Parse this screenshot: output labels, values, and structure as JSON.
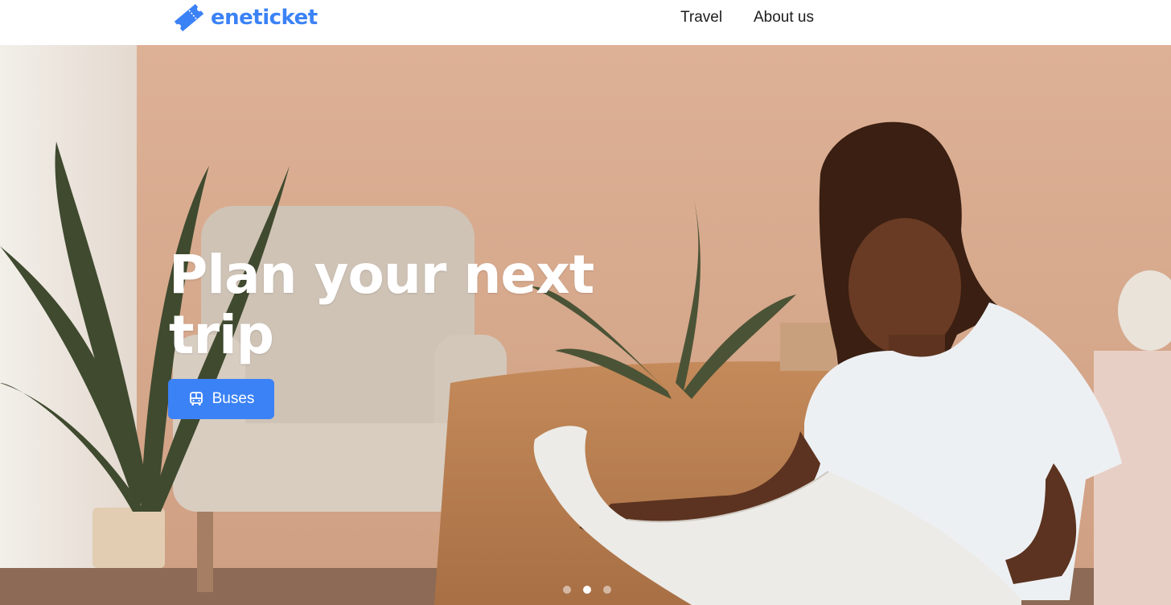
{
  "brand": {
    "name": "eneticket",
    "icon": "ticket-icon",
    "color": "#3b82f6"
  },
  "nav": {
    "links": [
      {
        "label": "Travel"
      },
      {
        "label": "About us"
      }
    ]
  },
  "hero": {
    "title": "Plan your next trip",
    "button": {
      "label": "Buses",
      "icon": "bus-icon",
      "color": "#3b82f6"
    },
    "carousel": {
      "slide_count": 3,
      "active_index": 1
    }
  }
}
